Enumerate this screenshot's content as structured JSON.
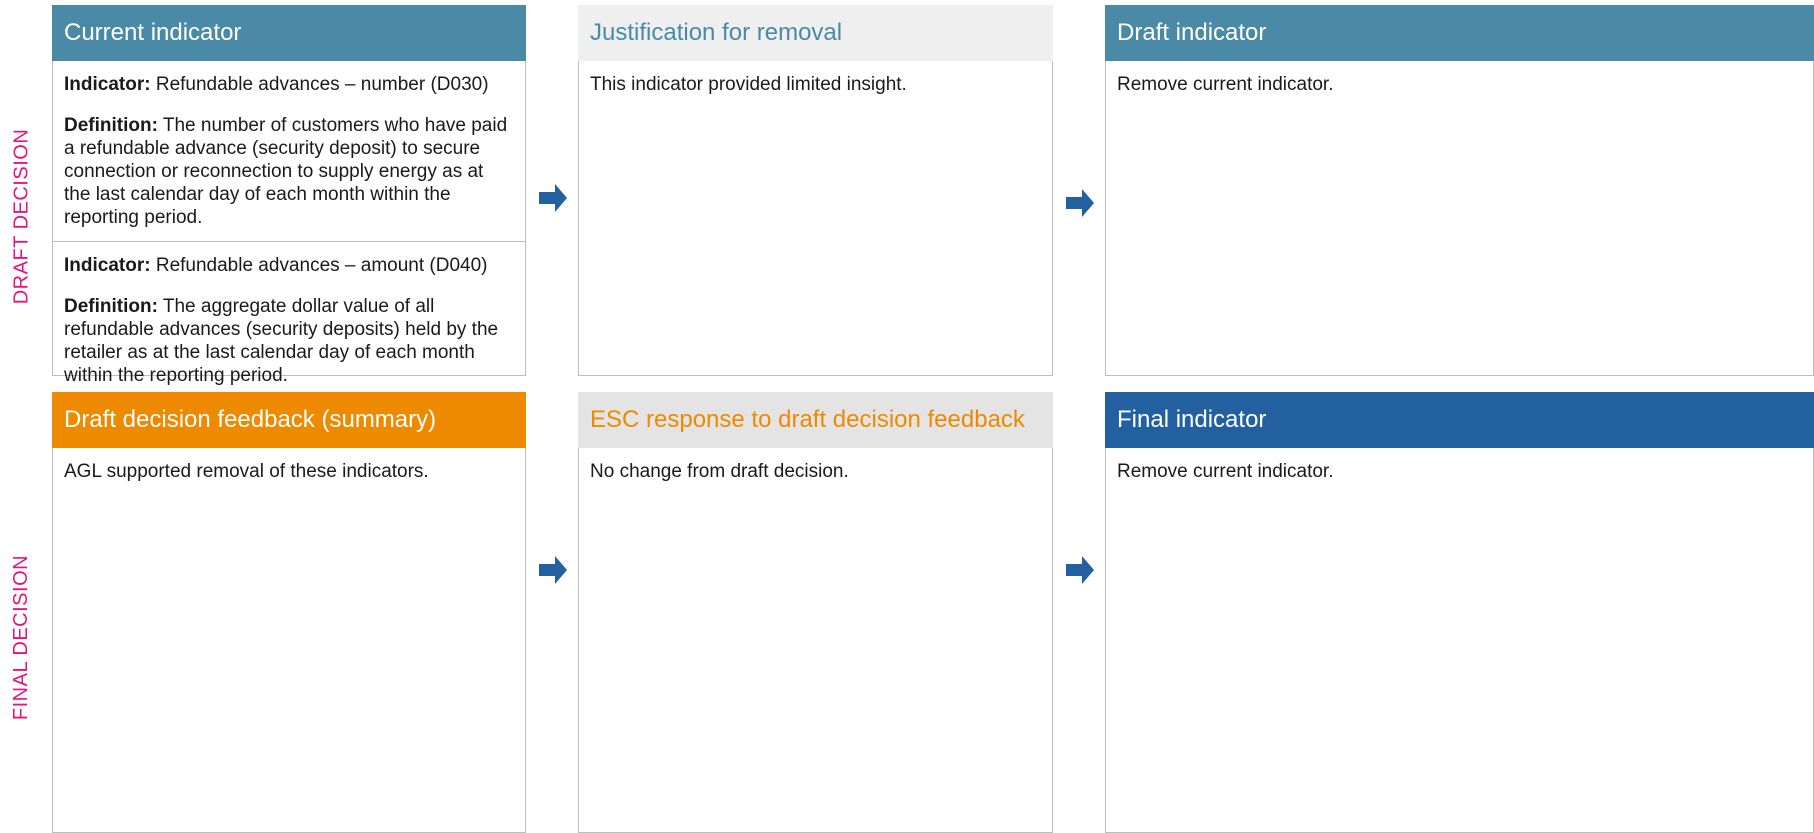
{
  "row_labels": {
    "draft": "DRAFT DECISION",
    "final": "FINAL DECISION"
  },
  "draft_row": {
    "current_indicator": {
      "header": "Current indicator",
      "items": [
        {
          "indicator_label": "Indicator:",
          "indicator_text": " Refundable advances – number (D030)",
          "definition_label": "Definition:",
          "definition_text": " The number of customers who have paid a refundable advance (security deposit) to secure connection or reconnection to supply energy as at the last calendar day of each month within the reporting period."
        },
        {
          "indicator_label": "Indicator:",
          "indicator_text": " Refundable advances – amount (D040)",
          "definition_label": "Definition:",
          "definition_text": " The aggregate dollar value of all refundable advances (security deposits) held by the retailer as at the last calendar day of each month within the reporting period."
        }
      ]
    },
    "justification": {
      "header": "Justification for removal",
      "body": "This indicator provided limited insight."
    },
    "draft_indicator": {
      "header": "Draft indicator",
      "body": "Remove current indicator."
    }
  },
  "final_row": {
    "feedback": {
      "header": "Draft decision feedback (summary)",
      "body": "AGL supported removal of these indicators."
    },
    "esc_response": {
      "header": "ESC response to draft decision feedback",
      "body": "No change from draft decision."
    },
    "final_indicator": {
      "header": "Final indicator",
      "body": "Remove current indicator."
    }
  },
  "colors": {
    "row_label": "#e5137f",
    "header_blue": "#4a8aa6",
    "header_orange": "#ee8a00",
    "header_navy": "#2260a0",
    "arrow": "#2260a0"
  },
  "icons": {
    "arrow": "right-arrow-icon"
  }
}
